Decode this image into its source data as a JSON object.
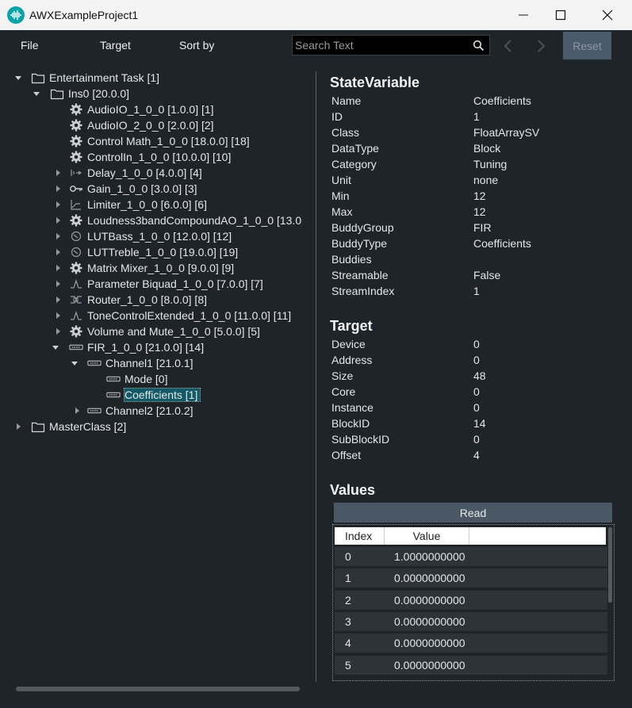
{
  "window": {
    "title": "AWXExampleProject1"
  },
  "menu": {
    "file": "File",
    "target": "Target",
    "sort_by": "Sort by"
  },
  "search": {
    "placeholder": "Search Text"
  },
  "toolbar": {
    "reset_label": "Reset"
  },
  "tree": [
    {
      "label": "Entertainment Task [1]",
      "icon": "folder-icon",
      "toggle": "expanded"
    },
    {
      "label": "Ins0 [20.0.0]",
      "icon": "folder-icon",
      "toggle": "expanded"
    },
    {
      "label": "AudioIO_1_0_0 [1.0.0] [1]",
      "icon": "gear-icon",
      "toggle": "none"
    },
    {
      "label": "AudioIO_2_0_0 [2.0.0] [2]",
      "icon": "gear-icon",
      "toggle": "none"
    },
    {
      "label": "Control Math_1_0_0 [18.0.0] [18]",
      "icon": "gear-icon",
      "toggle": "none"
    },
    {
      "label": "ControlIn_1_0_0 [10.0.0] [10]",
      "icon": "gear-icon",
      "toggle": "none"
    },
    {
      "label": "Delay_1_0_0 [4.0.0] [4]",
      "icon": "delay-icon",
      "toggle": "collapsed"
    },
    {
      "label": "Gain_1_0_0 [3.0.0] [3]",
      "icon": "gain-icon",
      "toggle": "collapsed"
    },
    {
      "label": "Limiter_1_0_0 [6.0.0] [6]",
      "icon": "limiter-icon",
      "toggle": "collapsed"
    },
    {
      "label": "Loudness3bandCompoundAO_1_0_0 [13.0",
      "icon": "gear-icon",
      "toggle": "collapsed"
    },
    {
      "label": "LUTBass_1_0_0 [12.0.0] [12]",
      "icon": "lut-icon",
      "toggle": "collapsed"
    },
    {
      "label": "LUTTreble_1_0_0 [19.0.0] [19]",
      "icon": "lut-icon",
      "toggle": "collapsed"
    },
    {
      "label": "Matrix Mixer_1_0_0 [9.0.0] [9]",
      "icon": "gear-icon",
      "toggle": "collapsed"
    },
    {
      "label": "Parameter Biquad_1_0_0 [7.0.0] [7]",
      "icon": "biquad-icon",
      "toggle": "collapsed"
    },
    {
      "label": "Router_1_0_0 [8.0.0] [8]",
      "icon": "router-icon",
      "toggle": "collapsed"
    },
    {
      "label": "ToneControlExtended_1_0_0 [11.0.0] [11]",
      "icon": "biquad-icon",
      "toggle": "collapsed"
    },
    {
      "label": "Volume and Mute_1_0_0 [5.0.0] [5]",
      "icon": "gear-icon",
      "toggle": "collapsed"
    },
    {
      "label": "FIR_1_0_0 [21.0.0] [14]",
      "icon": "block-icon",
      "toggle": "expanded"
    },
    {
      "label": "Channel1 [21.0.1]",
      "icon": "block-icon",
      "toggle": "expanded"
    },
    {
      "label": "Mode [0]",
      "icon": "block-icon",
      "toggle": "none"
    },
    {
      "label": "Coefficients [1]",
      "icon": "block-icon",
      "toggle": "none",
      "selected": true
    },
    {
      "label": "Channel2 [21.0.2]",
      "icon": "block-icon",
      "toggle": "collapsed"
    },
    {
      "label": "MasterClass [2]",
      "icon": "folder-icon",
      "toggle": "collapsed"
    }
  ],
  "state_variable": {
    "title": "StateVariable",
    "rows": [
      {
        "key": "Name",
        "value": "Coefficients"
      },
      {
        "key": "ID",
        "value": "1"
      },
      {
        "key": "Class",
        "value": "FloatArraySV"
      },
      {
        "key": "DataType",
        "value": "Block"
      },
      {
        "key": "Category",
        "value": "Tuning"
      },
      {
        "key": "Unit",
        "value": "none"
      },
      {
        "key": "Min",
        "value": "12"
      },
      {
        "key": "Max",
        "value": "12"
      },
      {
        "key": "BuddyGroup",
        "value": "FIR"
      },
      {
        "key": "BuddyType",
        "value": "Coefficients"
      },
      {
        "key": "Buddies",
        "value": ""
      },
      {
        "key": "Streamable",
        "value": "False"
      },
      {
        "key": "StreamIndex",
        "value": "1"
      }
    ]
  },
  "target": {
    "title": "Target",
    "rows": [
      {
        "key": "Device",
        "value": "0"
      },
      {
        "key": "Address",
        "value": "0"
      },
      {
        "key": "Size",
        "value": "48"
      },
      {
        "key": "Core",
        "value": "0"
      },
      {
        "key": "Instance",
        "value": "0"
      },
      {
        "key": "BlockID",
        "value": "14"
      },
      {
        "key": "SubBlockID",
        "value": "0"
      },
      {
        "key": "Offset",
        "value": "4"
      }
    ]
  },
  "values": {
    "title": "Values",
    "read_label": "Read",
    "columns": [
      "Index",
      "Value"
    ],
    "rows": [
      {
        "index": "0",
        "value": "1.0000000000"
      },
      {
        "index": "1",
        "value": "0.0000000000"
      },
      {
        "index": "2",
        "value": "0.0000000000"
      },
      {
        "index": "3",
        "value": "0.0000000000"
      },
      {
        "index": "4",
        "value": "0.0000000000"
      },
      {
        "index": "5",
        "value": "0.0000000000"
      }
    ]
  },
  "colors": {
    "background": "#1f2429",
    "titlebar": "#f3f3f3",
    "selection": "#125a68",
    "button": "#4a5866",
    "accent": "#0aa3a8"
  }
}
